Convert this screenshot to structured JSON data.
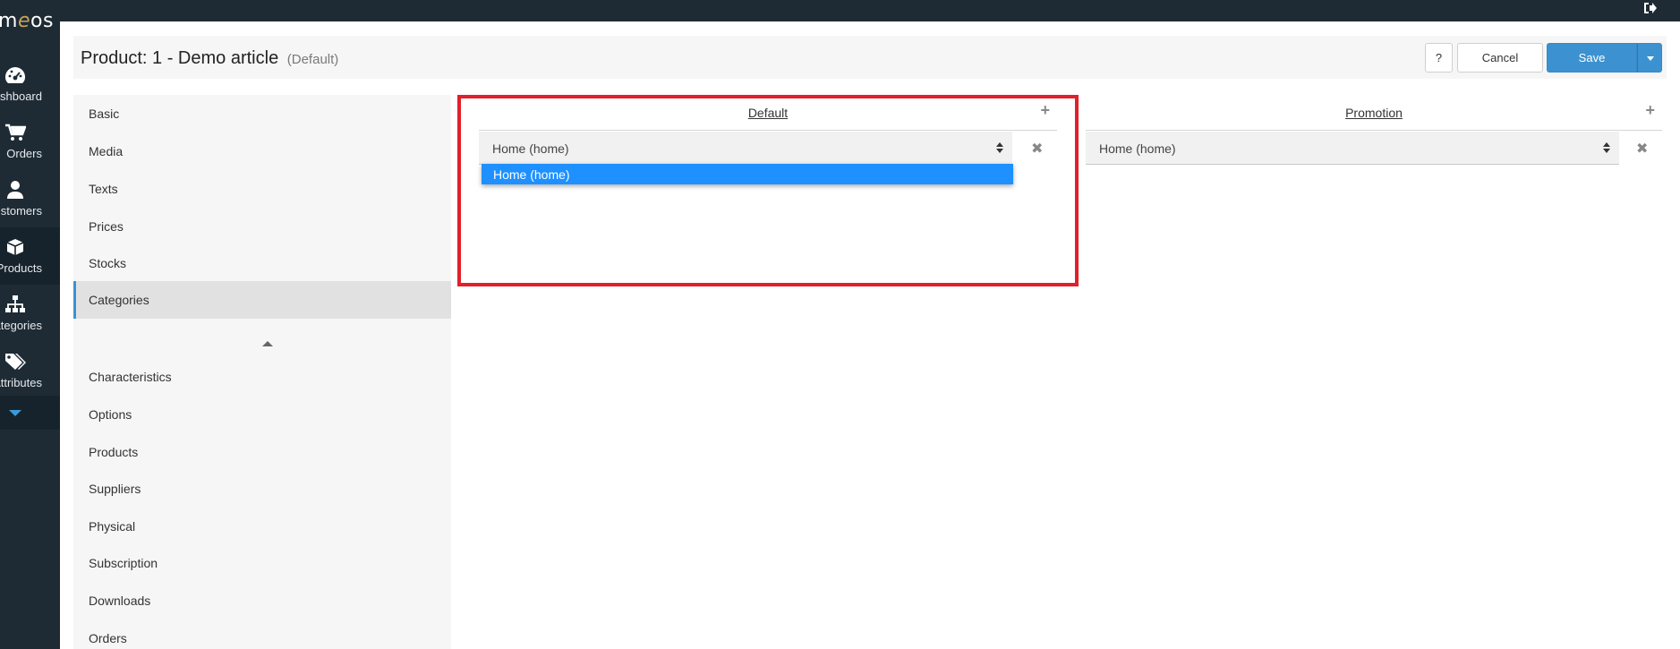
{
  "app": {
    "logo_prefix": "m",
    "logo_accent": "e",
    "logo_suffix": "os"
  },
  "nav": {
    "items": [
      {
        "label": "Dashboard",
        "icon": "dashboard-icon"
      },
      {
        "label": "Orders",
        "icon": "cart-icon"
      },
      {
        "label": "Customers",
        "icon": "user-icon"
      },
      {
        "label": "Products",
        "icon": "box-icon",
        "active": true
      },
      {
        "label": "Categories",
        "icon": "sitemap-icon"
      },
      {
        "label": "Attributes",
        "icon": "tags-icon"
      }
    ],
    "more_icon": "caret-down-icon"
  },
  "topbar": {
    "logout_icon": "sign-out-icon"
  },
  "header": {
    "title": "Product: 1 - Demo article",
    "subtitle": "(Default)",
    "help_label": "?",
    "cancel_label": "Cancel",
    "save_label": "Save"
  },
  "sections": {
    "items": [
      "Basic",
      "Media",
      "Texts",
      "Prices",
      "Stocks",
      "Categories",
      "Characteristics",
      "Options",
      "Products",
      "Suppliers",
      "Physical",
      "Subscription",
      "Downloads",
      "Orders"
    ],
    "active": "Categories"
  },
  "categories": {
    "columns": [
      {
        "name": "Default",
        "selected": "Home (home)"
      },
      {
        "name": "Promotion",
        "selected": "Home (home)"
      }
    ],
    "dropdown_option": "Home (home)"
  },
  "colors": {
    "nav_bg": "#1e2b35",
    "accent": "#3c92d0",
    "highlight": "#e0202a",
    "option_selected": "#1e90ff"
  }
}
